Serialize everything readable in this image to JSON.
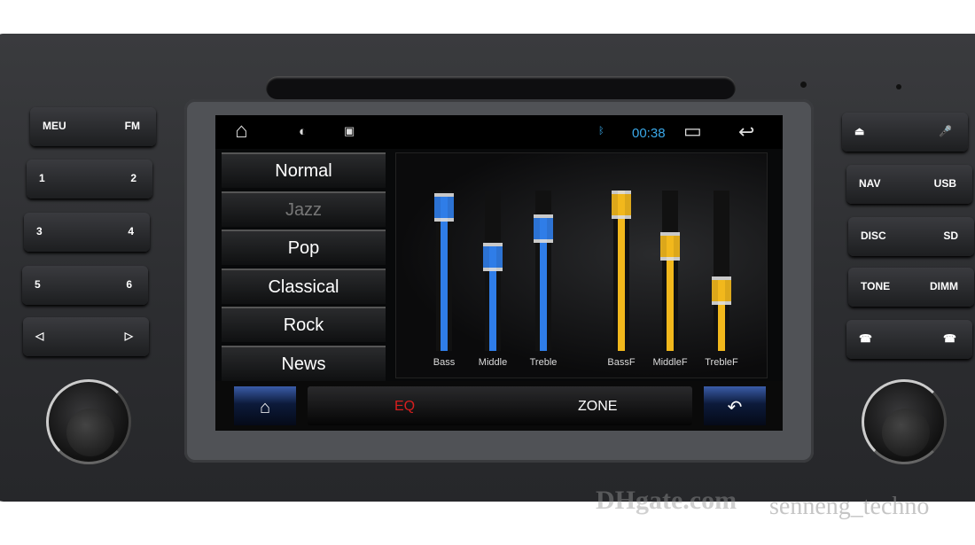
{
  "left_buttons": [
    {
      "left": "MEU",
      "right": "FM"
    },
    {
      "left": "1",
      "right": "2"
    },
    {
      "left": "3",
      "right": "4"
    },
    {
      "left": "5",
      "right": "6"
    },
    {
      "left": "◁",
      "right": "▷"
    }
  ],
  "right_buttons": [
    {
      "left": "⏏",
      "right": "🎤"
    },
    {
      "left": "NAV",
      "right": "USB"
    },
    {
      "left": "DISC",
      "right": "SD"
    },
    {
      "left": "TONE",
      "right": "DIMM"
    },
    {
      "left": "☎",
      "right": "☎"
    }
  ],
  "status": {
    "time": "00:38",
    "home_icon": "⌂",
    "brightness_icon": "◐",
    "image_icon": "▣",
    "bluetooth_icon": "ᛒ",
    "recent_icon": "▭",
    "back_icon": "↩",
    "accent": "#3aa8e8"
  },
  "presets": [
    {
      "label": "Normal",
      "active": true
    },
    {
      "label": "Jazz",
      "active": false
    },
    {
      "label": "Pop",
      "active": true
    },
    {
      "label": "Classical",
      "active": true
    },
    {
      "label": "Rock",
      "active": true
    },
    {
      "label": "News",
      "active": true
    }
  ],
  "sliders": [
    {
      "label": "Bass",
      "level": 0.96,
      "color": "#2f7de8"
    },
    {
      "label": "Middle",
      "level": 0.65,
      "color": "#2f7de8"
    },
    {
      "label": "Treble",
      "level": 0.83,
      "color": "#2f7de8"
    },
    {
      "label": "BassF",
      "level": 1.0,
      "color": "#f2b81c"
    },
    {
      "label": "MiddleF",
      "level": 0.72,
      "color": "#f2b81c"
    },
    {
      "label": "TrebleF",
      "level": 0.44,
      "color": "#f2b81c"
    }
  ],
  "bottom": {
    "home": "⌂",
    "tab_eq": "EQ",
    "tab_zone": "ZONE",
    "back": "↶",
    "eq_color": "#d81e1e"
  },
  "watermark": {
    "logo": "DHgate.com",
    "seller": "senneng_techno"
  }
}
